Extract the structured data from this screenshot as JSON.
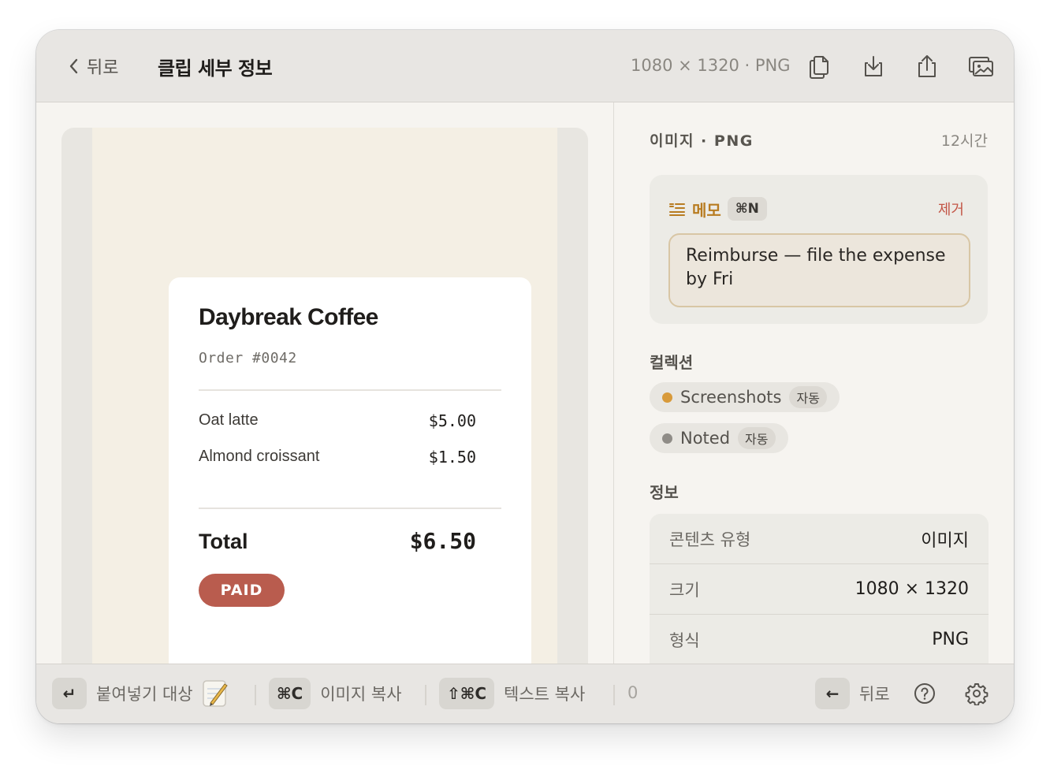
{
  "header": {
    "back_label": "뒤로",
    "title": "클립 세부 정보",
    "meta": "1080 × 1320 · PNG",
    "actions": [
      "copy-icon",
      "download-icon",
      "share-icon",
      "open-image-icon"
    ]
  },
  "preview": {
    "receipt": {
      "title": "Daybreak Coffee",
      "order": "Order #0042",
      "items": [
        {
          "name": "Oat latte",
          "price": "$5.00"
        },
        {
          "name": "Almond croissant",
          "price": "$1.50"
        }
      ],
      "total_label": "Total",
      "total_value": "$6.50",
      "status": "PAID"
    }
  },
  "details": {
    "kind": "이미지 · PNG",
    "age": "12시간",
    "memo": {
      "label": "메모",
      "shortcut": "⌘N",
      "remove": "제거",
      "text": "Reimburse — file the expense by Fri"
    },
    "collections_title": "컬렉션",
    "collections": [
      {
        "name": "Screenshots",
        "tag": "자동",
        "color": "#d89a3a"
      },
      {
        "name": "Noted",
        "tag": "자동",
        "color": "#8f8c87"
      }
    ],
    "info_title": "정보",
    "info": [
      {
        "key": "콘텐츠 유형",
        "value": "이미지"
      },
      {
        "key": "크기",
        "value": "1080 × 1320"
      },
      {
        "key": "형식",
        "value": "PNG"
      }
    ]
  },
  "footer": {
    "paste_key": "↵",
    "paste_label": "붙여넣기 대상",
    "copy_image_key": "⌘C",
    "copy_image_label": "이미지 복사",
    "copy_text_key": "⇧⌘C",
    "copy_text_label": "텍스트 복사",
    "count": "0",
    "back_key": "←",
    "back_label": "뒤로"
  },
  "colors": {
    "accent_memo": "#b87c21",
    "danger": "#c35546",
    "paid_badge": "#b95c4e"
  }
}
